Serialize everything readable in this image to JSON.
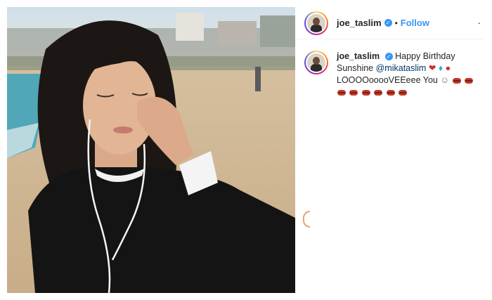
{
  "post": {
    "username": "joe_taslim",
    "follow_label": "Follow",
    "dot": "•",
    "more": "·"
  },
  "caption": {
    "username": "joe_taslim",
    "text_before": "Happy Birthday Sunshine",
    "mention": "@mikataslim",
    "text_after": "LOOOOooooVEEeee You"
  },
  "colors": {
    "verified": "#3897f0",
    "follow": "#3897f0",
    "mention": "#003569"
  },
  "icons": [
    "verified-badge-icon",
    "heart-emoji-icon",
    "diamond-emoji-icon",
    "lollipop-emoji-icon",
    "grimace-emoji-icon",
    "lips-emoji-icon"
  ]
}
